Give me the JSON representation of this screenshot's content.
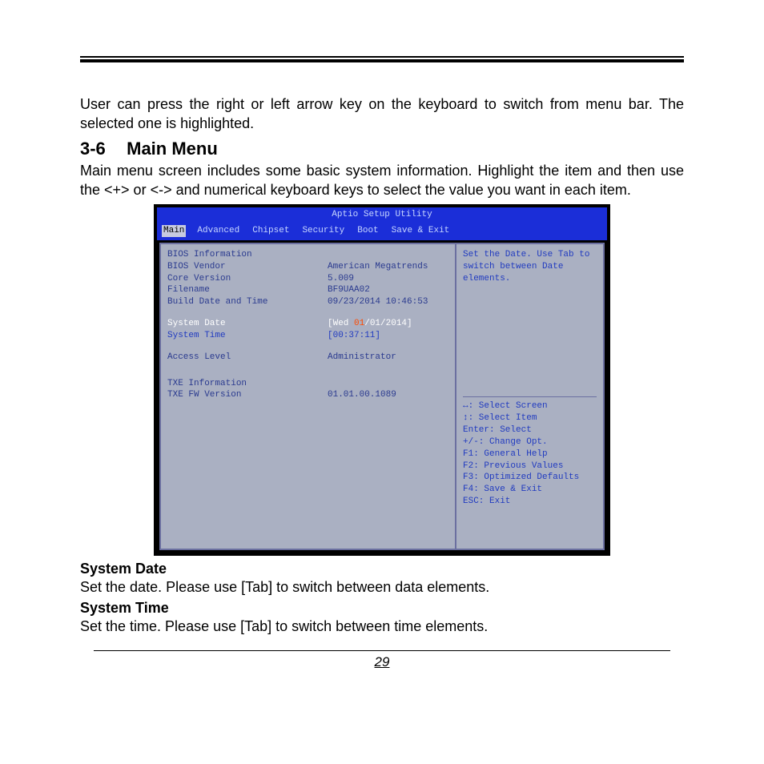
{
  "intro_paragraph": "User can press the right or left arrow key on the keyboard to switch from menu bar. The selected one is highlighted.",
  "section_number": "3-6",
  "section_title": "Main Menu",
  "section_desc": "Main menu screen includes some basic system information. Highlight the item and then use the <+> or <-> and numerical keyboard keys to select the value you want in each item.",
  "bios": {
    "title": "Aptio Setup Utility",
    "tabs": [
      "Main",
      "Advanced",
      "Chipset",
      "Security",
      "Boot",
      "Save & Exit"
    ],
    "active_tab": "Main",
    "groups": {
      "bios_info_heading": "BIOS Information",
      "bios_vendor_label": "BIOS Vendor",
      "bios_vendor_value": "American Megatrends",
      "core_version_label": "Core Version",
      "core_version_value": "5.009",
      "filename_label": "Filename",
      "filename_value": "BF9UAA02",
      "build_label": "Build Date and Time",
      "build_value": "09/23/2014 10:46:53",
      "system_date_label": "System Date",
      "system_date_prefix": "[Wed ",
      "system_date_hl": "01",
      "system_date_suffix": "/01/2014]",
      "system_time_label": "System Time",
      "system_time_value": "[00:37:11]",
      "access_level_label": "Access Level",
      "access_level_value": "Administrator",
      "txe_info_heading": "TXE Information",
      "txe_fw_label": "TXE FW Version",
      "txe_fw_value": "01.01.00.1089"
    },
    "help_top1": "Set the Date. Use Tab to",
    "help_top2": "switch between Date elements.",
    "help_items": [
      "↔: Select Screen",
      "↕: Select Item",
      "Enter: Select",
      "+/-: Change Opt.",
      "F1: General Help",
      "F2: Previous Values",
      "F3: Optimized Defaults",
      "F4: Save & Exit",
      "ESC: Exit"
    ]
  },
  "system_date_heading": "System Date",
  "system_date_text": "Set the date. Please use [Tab] to switch between data elements.",
  "system_time_heading": "System Time",
  "system_time_text": "Set the time. Please use [Tab] to switch between time elements.",
  "page_number": "29"
}
